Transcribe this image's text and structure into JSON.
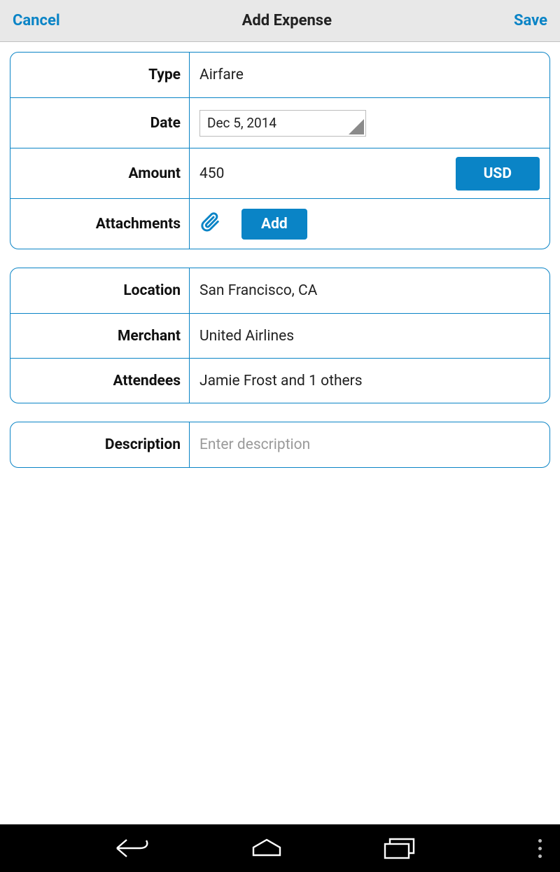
{
  "header": {
    "cancel": "Cancel",
    "title": "Add Expense",
    "save": "Save"
  },
  "fields": {
    "type": {
      "label": "Type",
      "value": "Airfare"
    },
    "date": {
      "label": "Date",
      "value": "Dec 5, 2014"
    },
    "amount": {
      "label": "Amount",
      "value": "450",
      "currency": "USD"
    },
    "attachments": {
      "label": "Attachments",
      "add_label": "Add"
    },
    "location": {
      "label": "Location",
      "value": "San Francisco, CA"
    },
    "merchant": {
      "label": "Merchant",
      "value": "United Airlines"
    },
    "attendees": {
      "label": "Attendees",
      "value": "Jamie Frost and 1 others"
    },
    "description": {
      "label": "Description",
      "placeholder": "Enter description"
    }
  }
}
